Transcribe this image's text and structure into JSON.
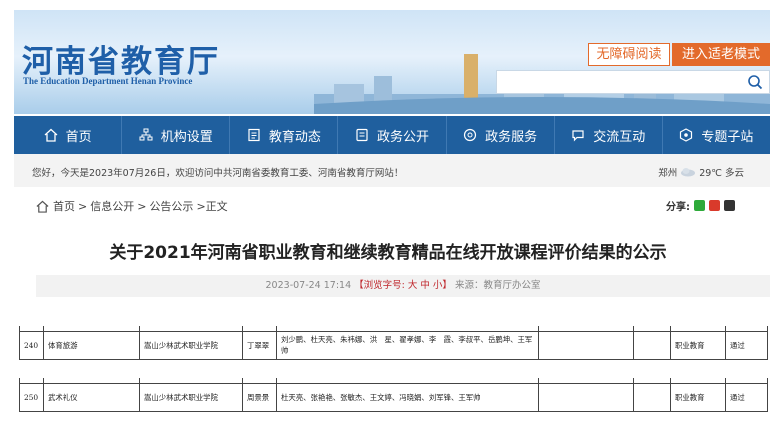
{
  "header": {
    "logo_cn": "河南省教育厅",
    "logo_en": "The Education Department Henan Province",
    "accessible_btn": "无障碍阅读",
    "elder_btn": "进入适老模式",
    "search_placeholder": ""
  },
  "nav": [
    {
      "label": "首页",
      "icon": "home-icon"
    },
    {
      "label": "机构设置",
      "icon": "org-icon"
    },
    {
      "label": "教育动态",
      "icon": "news-icon"
    },
    {
      "label": "政务公开",
      "icon": "doc-icon"
    },
    {
      "label": "政务服务",
      "icon": "service-icon"
    },
    {
      "label": "交流互动",
      "icon": "chat-icon"
    },
    {
      "label": "专题子站",
      "icon": "topic-icon"
    }
  ],
  "welcome": {
    "text": "您好，今天是2023年07月26日，欢迎访问中共河南省委教育工委、河南省教育厅网站！",
    "city": "郑州",
    "weather": "29℃ 多云"
  },
  "breadcrumb": {
    "home": "首页",
    "sep": ">",
    "level1": "信息公开",
    "level2": "公告公示",
    "current": ">正文"
  },
  "share": {
    "label": "分享:"
  },
  "article": {
    "title": "关于2021年河南省职业教育和继续教育精品在线开放课程评价结果的公示",
    "date": "2023-07-24 17:14",
    "font_label": "【浏览字号: 大 中 小】",
    "source": "来源：教育厅办公室"
  },
  "table_rows": [
    {
      "no": "240",
      "course": "体育旅游",
      "school": "嵩山少林武术职业学院",
      "leader": "丁翠翠",
      "members": "刘少鹏、杜天亮、朱祎娜、洪　星、翟孝娜、李　霞、李叔平、岳鹏坤、王军帅",
      "blank1": "",
      "blank2": "",
      "category": "职业教育",
      "result": "通过"
    },
    {
      "no": "250",
      "course": "武术礼仪",
      "school": "嵩山少林武术职业学院",
      "leader": "周景景",
      "members": "杜天亮、张艳艳、张敏杰、王文婷、冯晓娟、刘军锋、王军帅",
      "blank1": "",
      "blank2": "",
      "category": "职业教育",
      "result": "通过"
    }
  ],
  "colors": {
    "nav_bg": "#1f5f9e",
    "accent_orange": "#e36a2b",
    "logo_blue": "#1f5fa8",
    "red": "#c0282d"
  }
}
